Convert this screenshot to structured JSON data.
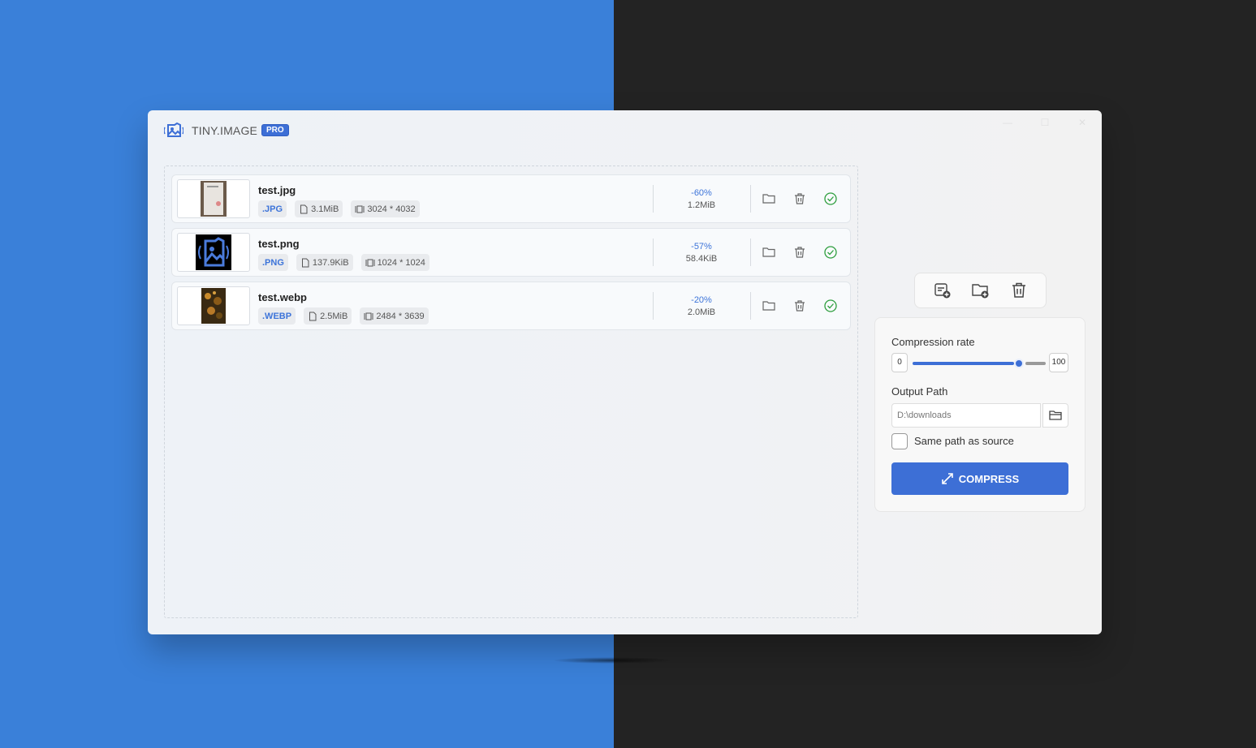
{
  "app": {
    "title": "TINY.IMAGE",
    "badge": "PRO"
  },
  "files": [
    {
      "name": "test.jpg",
      "ext": ".JPG",
      "size": "3.1MiB",
      "dimensions": "3024 * 4032",
      "reduction": "-60%",
      "new_size": "1.2MiB"
    },
    {
      "name": "test.png",
      "ext": ".PNG",
      "size": "137.9KiB",
      "dimensions": "1024 * 1024",
      "reduction": "-57%",
      "new_size": "58.4KiB"
    },
    {
      "name": "test.webp",
      "ext": ".WEBP",
      "size": "2.5MiB",
      "dimensions": "2484 * 3639",
      "reduction": "-20%",
      "new_size": "2.0MiB"
    }
  ],
  "settings": {
    "compression_label": "Compression rate",
    "min": "0",
    "max": "100",
    "compression_value": 80,
    "output_label": "Output Path",
    "output_path": "D:\\downloads",
    "same_path_label": "Same path as source",
    "same_path_checked": false,
    "compress_label": "COMPRESS"
  },
  "colors": {
    "accent": "#3d6fd6",
    "success": "#2e9e3e"
  }
}
